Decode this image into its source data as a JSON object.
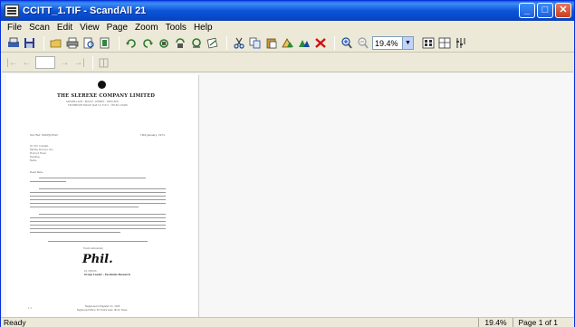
{
  "window": {
    "title": "CCITT_1.TIF - ScandAll 21"
  },
  "title_buttons": {
    "minimize": "_",
    "maximize": "□",
    "close": "✕"
  },
  "menu": [
    "File",
    "Scan",
    "Edit",
    "View",
    "Page",
    "Zoom",
    "Tools",
    "Help"
  ],
  "toolbar": {
    "zoom_value": "19.4%",
    "icons": [
      "scan-icon",
      "save-icon",
      "open-icon",
      "print-icon",
      "print-preview-icon",
      "page-icon",
      "rotate-left-icon",
      "rotate-right-icon",
      "rotate-icon",
      "rotate-180-icon",
      "flip-icon",
      "deskew-icon",
      "cut-icon",
      "copy-icon",
      "paste-icon",
      "select-icon",
      "crop-icon",
      "delete-icon",
      "zoom-in-icon",
      "zoom-out-icon",
      "single-page-icon",
      "multi-page-icon",
      "properties-icon"
    ]
  },
  "nav": {
    "first": "|←",
    "prev": "←",
    "next": "→",
    "last": "→|",
    "page_value": ""
  },
  "document": {
    "company": "THE SLEREXE COMPANY LIMITED",
    "address1": "SAPORS LANE - BOOLE - DORSET - BH25 8ER",
    "address2": "TELEPHONE BOOLE (945 13) 51617 - TELEX 123456",
    "ref": "Our Ref. 350/PJC/EAC",
    "date": "18th January, 1972.",
    "recipient": [
      "Dr. P.N. Cundall,",
      "Mining Surveys Ltd.,",
      "Holroyd Road,",
      "Reading,",
      "Berks."
    ],
    "salutation": "Dear Pete,",
    "signoff": "Yours sincerely,",
    "signer": [
      "Phil.",
      "P.J. CROSS",
      "Group Leader - Facsimile Research"
    ],
    "footer": [
      "Registered in England: No. 2038",
      "Registered Office: 60 Vicara Lane, Ilford, Essex."
    ],
    "page_mark": "1-1"
  },
  "status": {
    "ready": "Ready",
    "zoom": "19.4%",
    "page": "Page 1 of 1"
  }
}
